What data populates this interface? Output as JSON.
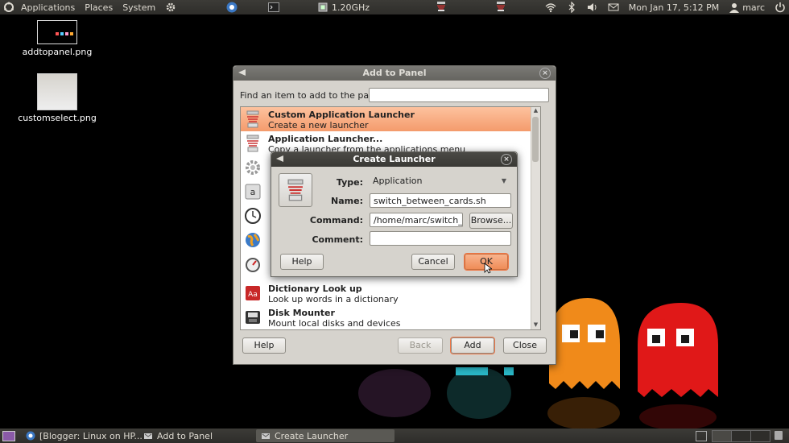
{
  "top_panel": {
    "menus": [
      "Applications",
      "Places",
      "System"
    ],
    "cpu_freq": "1.20GHz",
    "datetime": "Mon Jan 17,  5:12 PM",
    "user": "marc"
  },
  "desktop_icons": [
    {
      "label": "addtopanel.png"
    },
    {
      "label": "customselect.png"
    }
  ],
  "add_to_panel": {
    "title": "Add to Panel",
    "find_label": "Find an item to add to the panel:",
    "find_value": "",
    "items": [
      {
        "title": "Custom Application Launcher",
        "desc": "Create a new launcher",
        "icon": "launcher-icon",
        "selected": true
      },
      {
        "title": "Application Launcher...",
        "desc": "Copy a launcher from the applications menu",
        "icon": "launcher-icon"
      },
      {
        "title": "",
        "desc": "",
        "icon": "gear-icon"
      },
      {
        "title": "",
        "desc": "",
        "icon": "character-icon"
      },
      {
        "title": "",
        "desc": "",
        "icon": "clock-icon"
      },
      {
        "title": "",
        "desc": "",
        "icon": "globe-icon"
      },
      {
        "title": "",
        "desc": "",
        "icon": "gauge-icon"
      },
      {
        "title": "Dictionary Look up",
        "desc": "Look up words in a dictionary",
        "icon": "dictionary-icon"
      },
      {
        "title": "Disk Mounter",
        "desc": "Mount local disks and devices",
        "icon": "disk-icon"
      }
    ],
    "buttons": {
      "help": "Help",
      "back": "Back",
      "add": "Add",
      "close": "Close"
    }
  },
  "create_launcher": {
    "title": "Create Launcher",
    "type_label": "Type:",
    "type_value": "Application",
    "name_label": "Name:",
    "name_value": "switch_between_cards.sh",
    "command_label": "Command:",
    "command_value": "/home/marc/switch_be",
    "comment_label": "Comment:",
    "comment_value": "",
    "buttons": {
      "browse": "Browse...",
      "help": "Help",
      "cancel": "Cancel",
      "ok": "OK"
    }
  },
  "taskbar": {
    "tasks": [
      {
        "label": "[Blogger: Linux on HP..."
      },
      {
        "label": "Add to Panel"
      },
      {
        "label": "Create Launcher",
        "active": true
      }
    ]
  },
  "colors": {
    "selection": "#f49b6c",
    "panel": "#3c3b37",
    "dialog": "#d6d3cd"
  }
}
